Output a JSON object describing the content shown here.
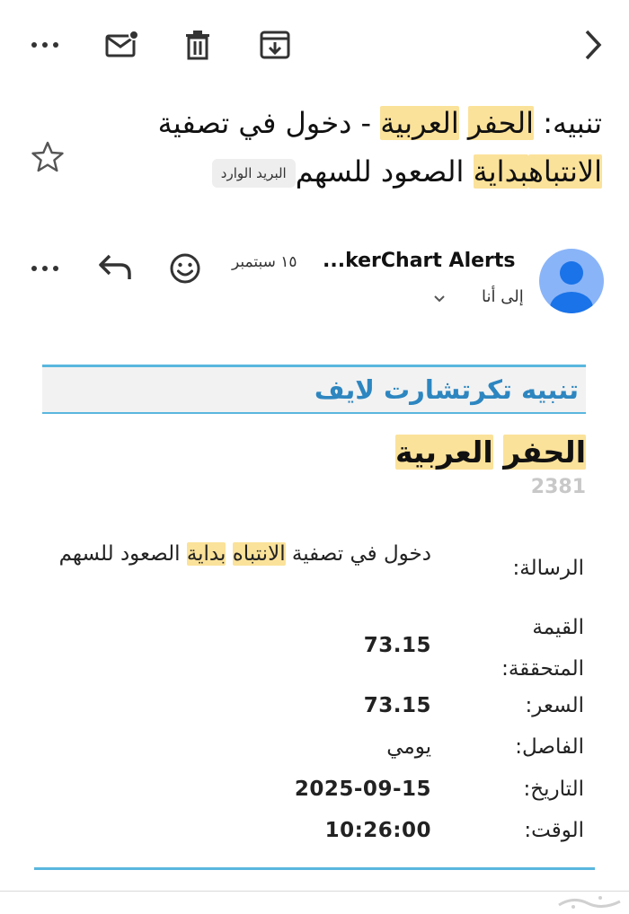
{
  "toolbar": {
    "more_icon": "more-horiz-icon",
    "mark_unread_icon": "mark-unread-icon",
    "delete_icon": "trash-icon",
    "archive_icon": "archive-icon",
    "back_icon": "chevron-right-icon"
  },
  "subject": {
    "line1_part1": "تنبيه: ",
    "line1_hl1": "الحفر",
    "line1_part2": " ",
    "line1_hl2": "العربية",
    "line1_part3": " - دخول في تصفية",
    "line2_hl1": "الانتباه",
    "line2_hl2": "بداية",
    "line2_part1": " الصعود للسهم",
    "label_chip": "البريد الوارد",
    "star_icon": "star-outline-icon"
  },
  "sender": {
    "name": "...kerChart Alerts",
    "date": "١٥ سبتمبر",
    "recipient": "إلى أنا",
    "avatar_icon": "person-avatar-icon",
    "reaction_icon": "emoji-smile-icon",
    "reply_icon": "reply-icon",
    "more_icon": "more-horiz-icon",
    "expand_icon": "chevron-down-icon"
  },
  "email": {
    "header_title": "تنبيه تكرتشارت لايف",
    "stock_name_hl1": "الحفر",
    "stock_name_hl2": "العربية",
    "stock_code": "2381",
    "rows": {
      "message_label": "الرسالة:",
      "message_part1": "دخول في تصفية ",
      "message_hl1": "الانتباه",
      "message_hl2": "بداية",
      "message_part2": " الصعود للسهم",
      "achieved_label_1": "القيمة",
      "achieved_label_2": "المتحققة:",
      "achieved_value": "73.15",
      "price_label": "السعر:",
      "price_value": "73.15",
      "interval_label": "الفاصل:",
      "interval_value": "يومي",
      "date_label": "التاريخ:",
      "date_value": "2025-09-15",
      "time_label": "الوقت:",
      "time_value": "10:26:00"
    }
  },
  "colors": {
    "highlight": "#fbe29a",
    "accent_line": "#59b7de",
    "header_title": "#2d86c0",
    "avatar_bg": "#8ab4f8",
    "avatar_fg": "#1a73e8"
  }
}
